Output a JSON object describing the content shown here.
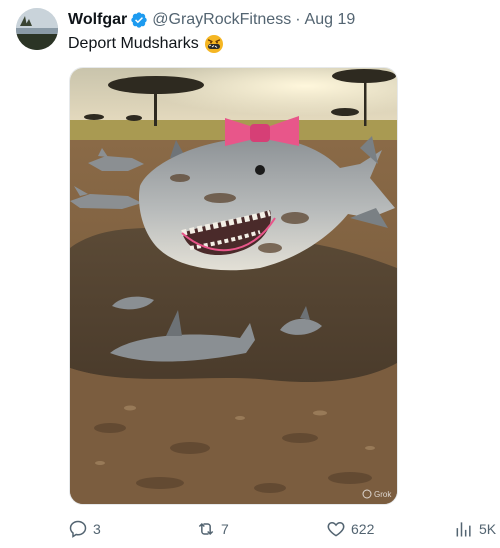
{
  "tweet": {
    "author_name": "Wolfgar",
    "handle": "@GrayRockFitness",
    "separator": "·",
    "date": "Aug 19",
    "text": "Deport Mudsharks",
    "emoji": "face-with-symbols-on-mouth",
    "media": {
      "icons": [
        "shark-image"
      ],
      "watermark": "Grok"
    }
  },
  "actions": {
    "reply_count": "3",
    "repost_count": "7",
    "like_count": "622",
    "views_count": "5K"
  },
  "colors": {
    "verified_blue": "#1d9bf0",
    "text_primary": "#0f1419",
    "text_secondary": "#536471",
    "bow_pink": "#e8568a"
  }
}
